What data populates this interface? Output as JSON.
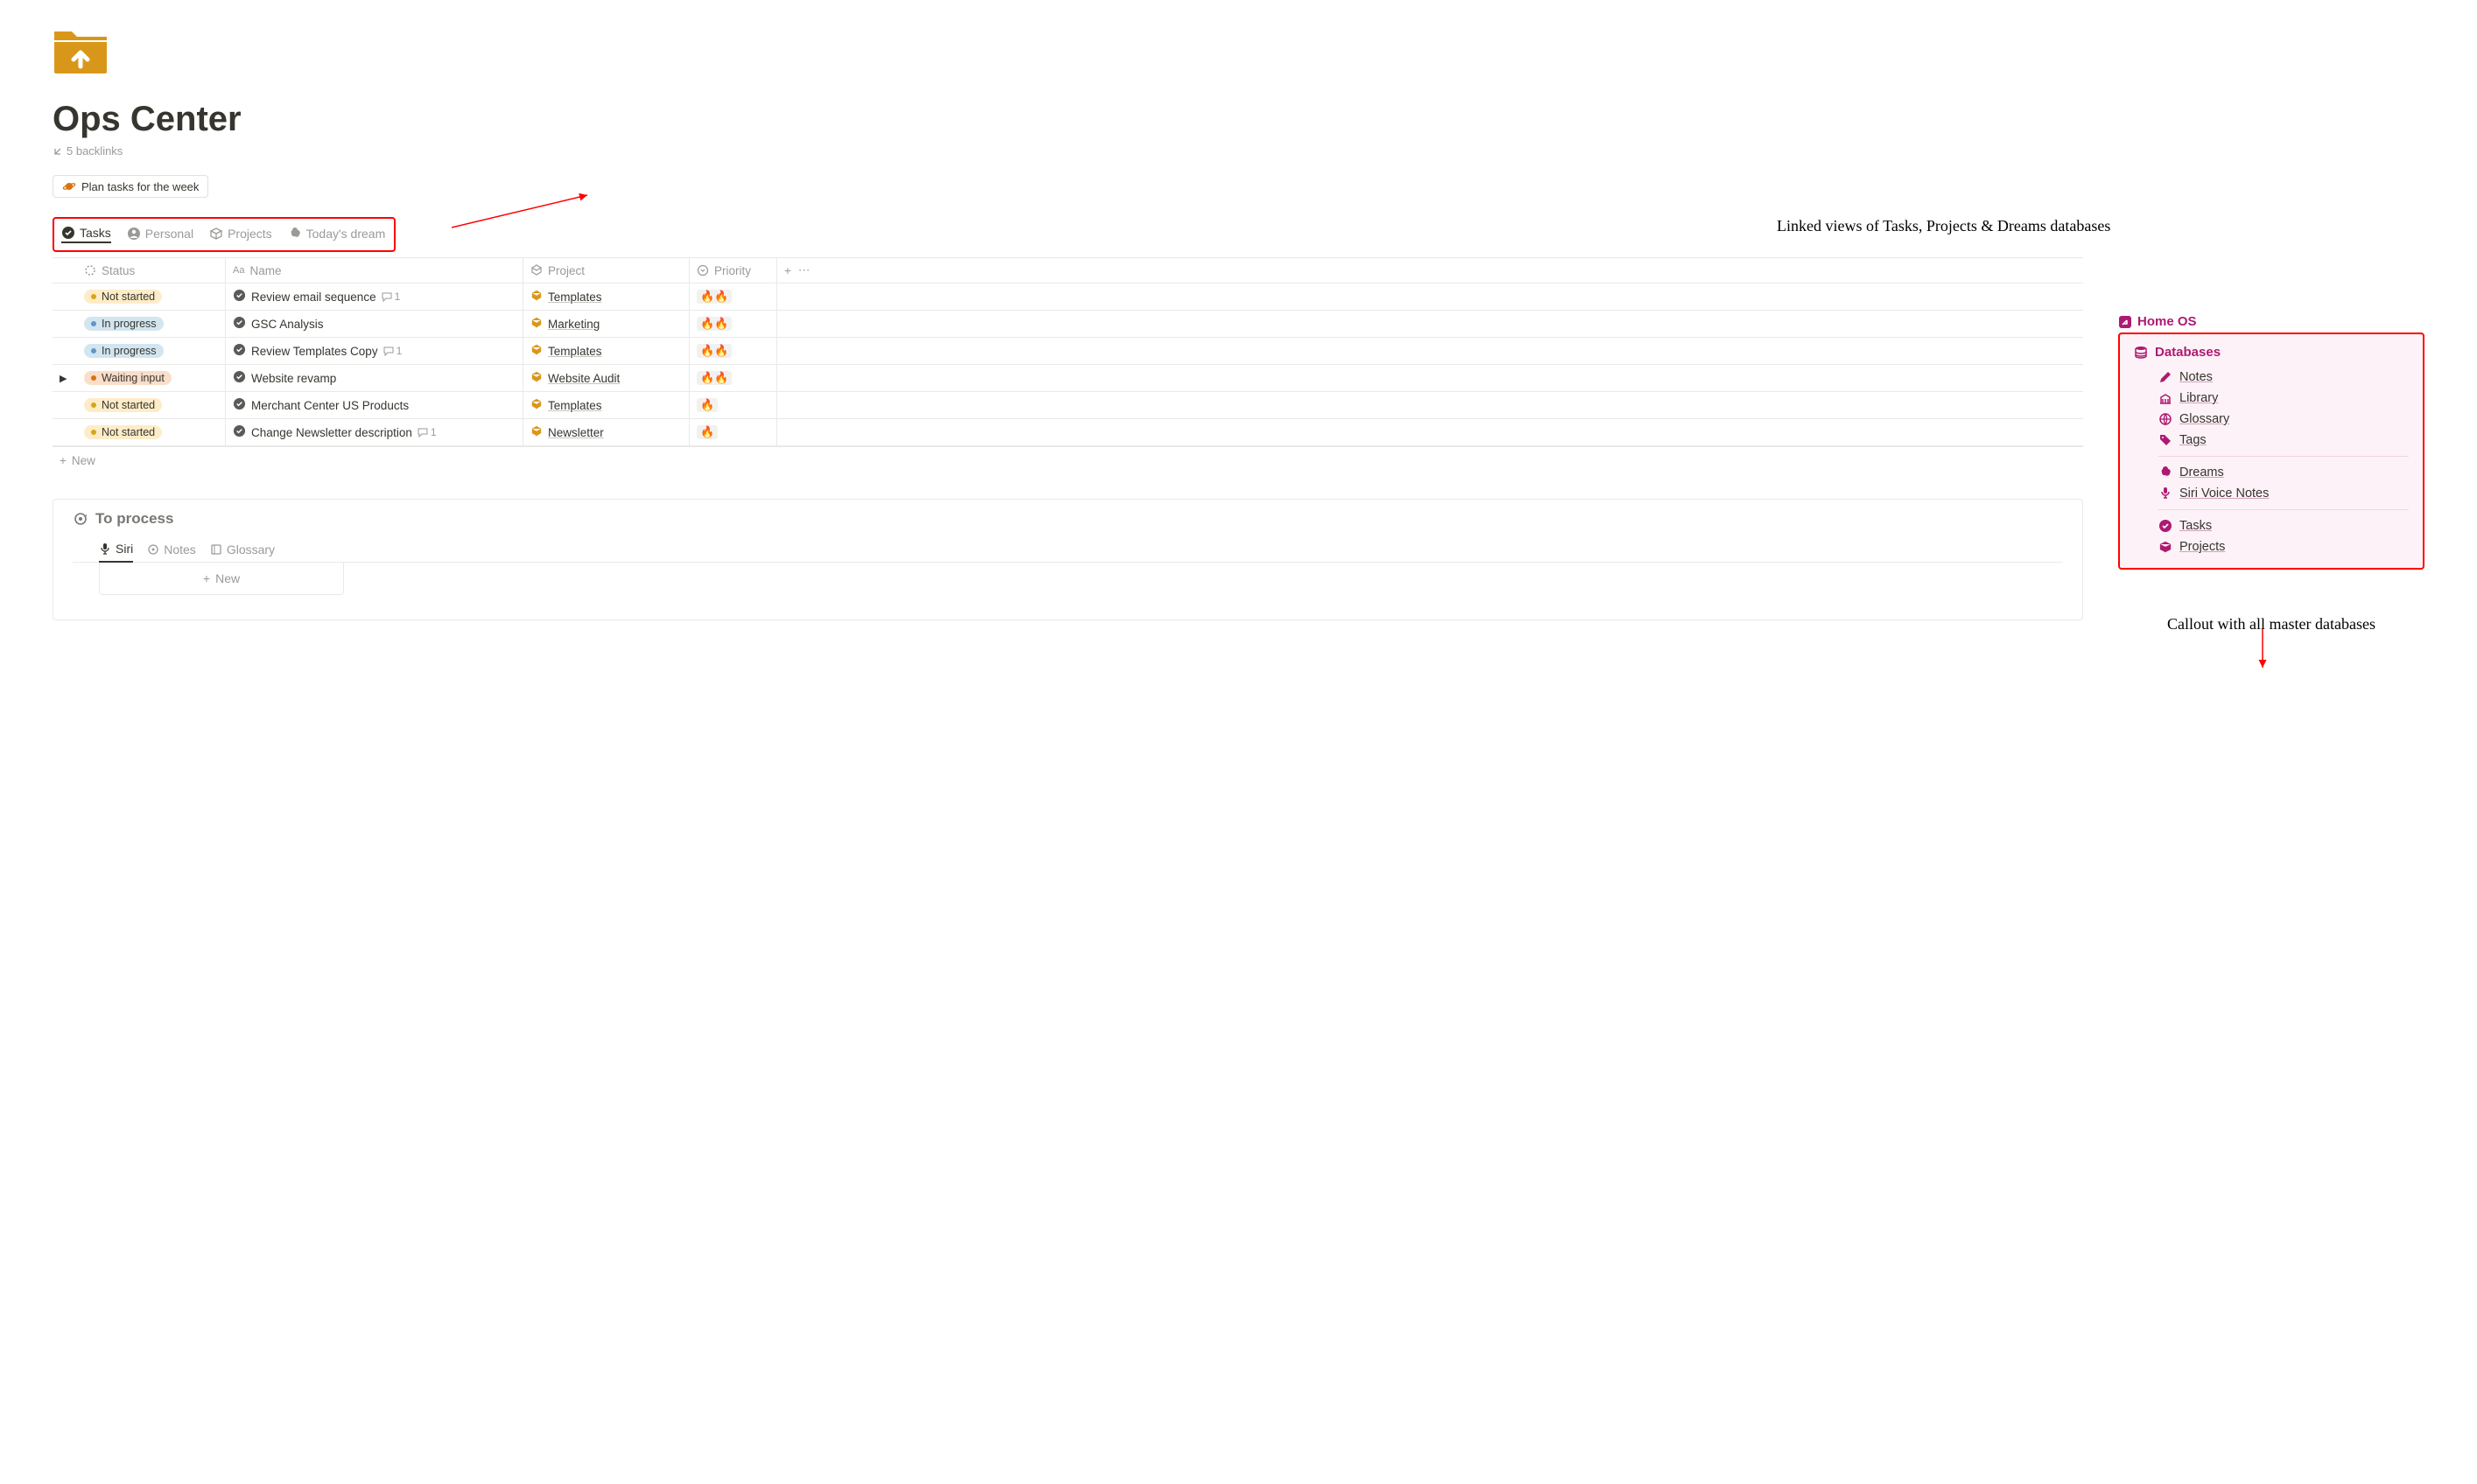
{
  "page": {
    "title": "Ops Center",
    "backlinks": "5 backlinks",
    "plan_button": "Plan tasks for the week"
  },
  "annotations": {
    "top": "Linked views of Tasks, Projects & Dreams databases",
    "bottom": "Callout with all master databases"
  },
  "tabs": [
    {
      "label": "Tasks",
      "active": true
    },
    {
      "label": "Personal",
      "active": false
    },
    {
      "label": "Projects",
      "active": false
    },
    {
      "label": "Today's dream",
      "active": false
    }
  ],
  "table": {
    "headers": {
      "status": "Status",
      "name": "Name",
      "project": "Project",
      "priority": "Priority"
    },
    "rows": [
      {
        "status": "Not started",
        "status_class": "yellow",
        "name": "Review email sequence",
        "comments": "1",
        "project": "Templates",
        "priority": "🔥🔥"
      },
      {
        "status": "In progress",
        "status_class": "blue",
        "name": "GSC Analysis",
        "comments": "",
        "project": "Marketing",
        "priority": "🔥🔥"
      },
      {
        "status": "In progress",
        "status_class": "blue",
        "name": "Review Templates Copy",
        "comments": "1",
        "project": "Templates",
        "priority": "🔥🔥"
      },
      {
        "status": "Waiting input",
        "status_class": "orange",
        "name": "Website revamp",
        "comments": "",
        "project": "Website Audit",
        "priority": "🔥🔥",
        "has_subitems": true
      },
      {
        "status": "Not started",
        "status_class": "yellow",
        "name": "Merchant Center US Products",
        "comments": "",
        "project": "Templates",
        "priority": "🔥"
      },
      {
        "status": "Not started",
        "status_class": "yellow",
        "name": "Change Newsletter description",
        "comments": "1",
        "project": "Newsletter",
        "priority": "🔥"
      }
    ],
    "new_label": "New"
  },
  "process": {
    "title": "To process",
    "tabs": [
      {
        "label": "Siri",
        "active": true
      },
      {
        "label": "Notes",
        "active": false
      },
      {
        "label": "Glossary",
        "active": false
      }
    ],
    "new_label": "New"
  },
  "sidebar": {
    "home_os": "Home OS",
    "header": "Databases",
    "group1": [
      {
        "icon": "pencil",
        "label": "Notes"
      },
      {
        "icon": "library",
        "label": "Library"
      },
      {
        "icon": "globe",
        "label": "Glossary"
      },
      {
        "icon": "tag",
        "label": "Tags"
      }
    ],
    "group2": [
      {
        "icon": "thought",
        "label": "Dreams"
      },
      {
        "icon": "mic",
        "label": "Siri Voice Notes"
      }
    ],
    "group3": [
      {
        "icon": "check",
        "label": "Tasks"
      },
      {
        "icon": "box",
        "label": "Projects"
      }
    ]
  }
}
